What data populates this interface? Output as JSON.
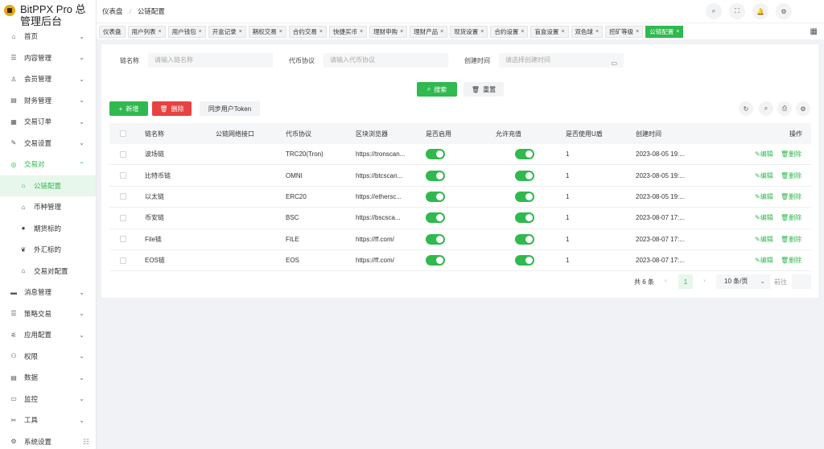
{
  "app": {
    "title": "BitPPX Pro 总管理后台"
  },
  "sidebar": {
    "items": [
      {
        "label": "首页",
        "icon": "⌂",
        "chev": "⌄"
      },
      {
        "label": "内容管理",
        "icon": "☰",
        "chev": "⌄"
      },
      {
        "label": "会员管理",
        "icon": "♙",
        "chev": "⌄"
      },
      {
        "label": "财务管理",
        "icon": "▤",
        "chev": "⌄"
      },
      {
        "label": "交易订单",
        "icon": "▦",
        "chev": "⌄"
      },
      {
        "label": "交易设置",
        "icon": "✎",
        "chev": "⌄"
      },
      {
        "label": "交易对",
        "icon": "◎",
        "chev": "⌃"
      }
    ],
    "sub_items": [
      {
        "label": "公链配置",
        "icon": "⌂"
      },
      {
        "label": "币种管理",
        "icon": "⌂"
      },
      {
        "label": "期货标的",
        "icon": "●"
      },
      {
        "label": "外汇标的",
        "icon": "❦"
      },
      {
        "label": "交易对配置",
        "icon": "⌂"
      }
    ],
    "items_after": [
      {
        "label": "消息管理",
        "icon": "▬",
        "chev": "⌄"
      },
      {
        "label": "策略交易",
        "icon": "☰",
        "chev": "⌄"
      },
      {
        "label": "应用配置",
        "icon": "⚟",
        "chev": "⌄"
      },
      {
        "label": "权限",
        "icon": "⚇",
        "chev": "⌄"
      },
      {
        "label": "数据",
        "icon": "▤",
        "chev": "⌄"
      },
      {
        "label": "监控",
        "icon": "▭",
        "chev": "⌄"
      },
      {
        "label": "工具",
        "icon": "✂",
        "chev": "⌄"
      },
      {
        "label": "系统设置",
        "icon": "⚙",
        "chev": ""
      }
    ],
    "collapse_icon": "☷"
  },
  "header": {
    "breadcrumb": [
      "仪表盘",
      "公链配置"
    ],
    "separator": "/",
    "icons": [
      "⌕",
      "⛶",
      "🔔",
      "⚙"
    ]
  },
  "tabs": [
    {
      "label": "仪表盘",
      "closable": false,
      "active": false
    },
    {
      "label": "用户列表",
      "closable": true,
      "active": false
    },
    {
      "label": "用户钱包",
      "closable": true,
      "active": false
    },
    {
      "label": "开盒记录",
      "closable": true,
      "active": false
    },
    {
      "label": "期权交易",
      "closable": true,
      "active": false
    },
    {
      "label": "合约交易",
      "closable": true,
      "active": false
    },
    {
      "label": "快捷买币",
      "closable": true,
      "active": false
    },
    {
      "label": "理财申购",
      "closable": true,
      "active": false
    },
    {
      "label": "理财产品",
      "closable": true,
      "active": false
    },
    {
      "label": "现货设置",
      "closable": true,
      "active": false
    },
    {
      "label": "合约设置",
      "closable": true,
      "active": false
    },
    {
      "label": "盲盒设置",
      "closable": true,
      "active": false
    },
    {
      "label": "双色球",
      "closable": true,
      "active": false
    },
    {
      "label": "挖矿等级",
      "closable": true,
      "active": false
    },
    {
      "label": "公链配置",
      "closable": true,
      "active": true
    }
  ],
  "tab_close_glyph": "×",
  "tabs_menu_icon": "▦",
  "filters": {
    "chain_name_label": "链名称",
    "chain_name_placeholder": "请输入链名称",
    "protocol_label": "代币协议",
    "protocol_placeholder": "请输入代币协议",
    "created_label": "创建时间",
    "created_placeholder": "请选择创建时间",
    "calendar_icon": "▭"
  },
  "actions": {
    "search": "搜索",
    "search_icon": "⌕",
    "reset": "重置",
    "reset_icon": "🗑",
    "add": "新增",
    "add_icon": "+",
    "delete": "删除",
    "delete_icon": "🗑",
    "sync_token": "同步用户Token"
  },
  "toolbar": {
    "icons": [
      "↻",
      "⌕",
      "⎙",
      "⚙"
    ]
  },
  "table": {
    "columns": [
      "链名称",
      "公链网络接口",
      "代币协议",
      "区块浏览器",
      "是否启用",
      "允许充值",
      "是否使用U盾",
      "创建时间",
      "操作"
    ],
    "edit_label": "✎编辑",
    "delete_label": "🗑删除",
    "rows": [
      {
        "name": "波场链",
        "api": "",
        "protocol": "TRC20(Tron)",
        "explorer": "https://tronscan...",
        "enabled": true,
        "recharge": true,
        "ushield": "1",
        "created": "2023-08-05 19:..."
      },
      {
        "name": "比特币链",
        "api": "",
        "protocol": "OMNI",
        "explorer": "https://btcscan...",
        "enabled": true,
        "recharge": true,
        "ushield": "1",
        "created": "2023-08-05 19:..."
      },
      {
        "name": "以太链",
        "api": "",
        "protocol": "ERC20",
        "explorer": "https://ethersc...",
        "enabled": true,
        "recharge": true,
        "ushield": "1",
        "created": "2023-08-05 19:..."
      },
      {
        "name": "币安链",
        "api": "",
        "protocol": "BSC",
        "explorer": "https://bscsca...",
        "enabled": true,
        "recharge": true,
        "ushield": "1",
        "created": "2023-08-07 17:..."
      },
      {
        "name": "File链",
        "api": "",
        "protocol": "FILE",
        "explorer": "https://ff.com/",
        "enabled": true,
        "recharge": true,
        "ushield": "1",
        "created": "2023-08-07 17:..."
      },
      {
        "name": "EOS链",
        "api": "",
        "protocol": "EOS",
        "explorer": "https://ff.com/",
        "enabled": true,
        "recharge": true,
        "ushield": "1",
        "created": "2023-08-07 17:..."
      }
    ]
  },
  "pagination": {
    "total": "共 6 条",
    "prev": "‹",
    "page": "1",
    "next": "›",
    "page_size": "10 条/页",
    "page_size_dd": "⌄",
    "goto_label": "前往"
  },
  "colors": {
    "accent": "#2fb94e",
    "danger": "#e84141"
  }
}
